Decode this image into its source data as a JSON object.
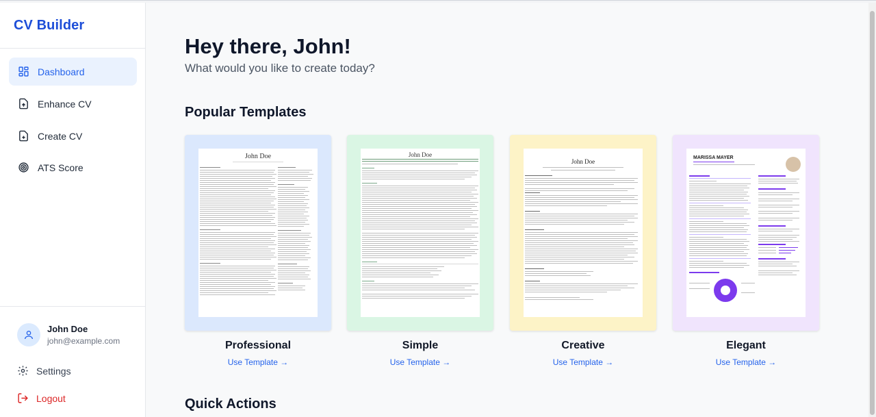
{
  "app": {
    "brand": "CV Builder"
  },
  "sidebar": {
    "items": [
      {
        "label": "Dashboard",
        "icon": "dashboard-grid-icon",
        "active": true
      },
      {
        "label": "Enhance CV",
        "icon": "file-upload-icon",
        "active": false
      },
      {
        "label": "Create CV",
        "icon": "file-plus-icon",
        "active": false
      },
      {
        "label": "ATS Score",
        "icon": "target-icon",
        "active": false
      }
    ],
    "user": {
      "name": "John Doe",
      "email": "john@example.com"
    },
    "settings_label": "Settings",
    "logout_label": "Logout"
  },
  "main": {
    "greeting": "Hey there, John!",
    "subtitle": "What would you like to create today?",
    "popular_title": "Popular Templates",
    "quick_actions_title": "Quick Actions",
    "templates": [
      {
        "name": "Professional",
        "action": "Use Template →",
        "bg": "#dbe8fd",
        "preview_name": "John Doe"
      },
      {
        "name": "Simple",
        "action": "Use Template →",
        "bg": "#daf6e4",
        "preview_name": "John Doe"
      },
      {
        "name": "Creative",
        "action": "Use Template →",
        "bg": "#fdf3c7",
        "preview_name": "John Doe"
      },
      {
        "name": "Elegant",
        "action": "Use Template →",
        "bg": "#f0e4fd",
        "preview_name": "MARISSA MAYER"
      }
    ]
  },
  "colors": {
    "accent": "#2563eb",
    "brand": "#1d4ed8",
    "danger": "#dc2626"
  }
}
